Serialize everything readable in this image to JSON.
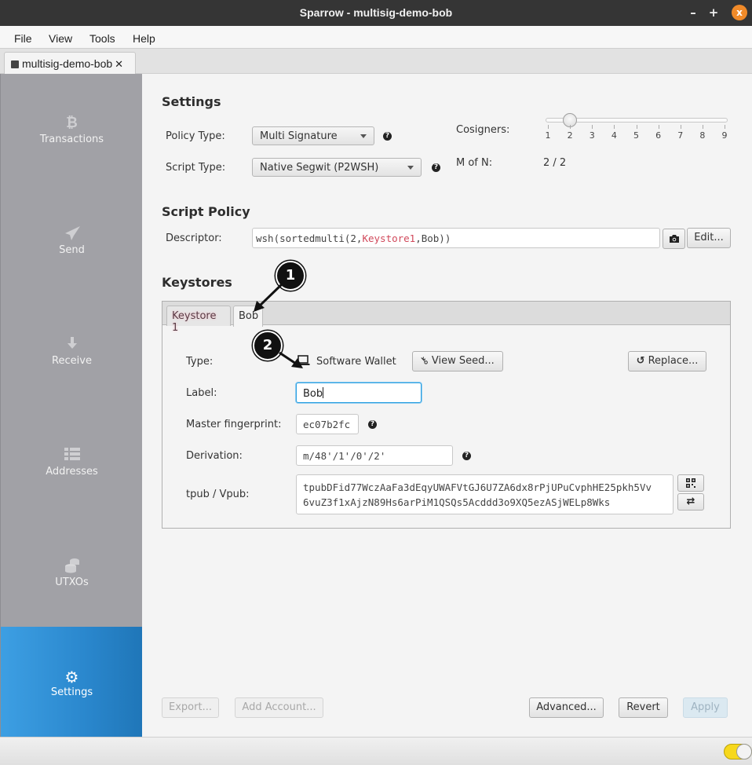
{
  "window": {
    "title": "Sparrow - multisig-demo-bob",
    "minimize": "–",
    "maximize": "+",
    "close": "x"
  },
  "menu": [
    "File",
    "View",
    "Tools",
    "Help"
  ],
  "wallet_tab": {
    "label": "multisig-demo-bob",
    "close": "✕"
  },
  "sidebar": {
    "items": [
      {
        "label": "Transactions",
        "icon": "bitcoin-icon",
        "glyph": "₿"
      },
      {
        "label": "Send",
        "icon": "paper-plane-icon",
        "glyph": "➤"
      },
      {
        "label": "Receive",
        "icon": "arrow-down-icon",
        "glyph": "⬇"
      },
      {
        "label": "Addresses",
        "icon": "list-icon",
        "glyph": "☰"
      },
      {
        "label": "UTXOs",
        "icon": "coins-icon",
        "glyph": "⛁"
      },
      {
        "label": "Settings",
        "icon": "gear-icon",
        "glyph": "⚙"
      }
    ],
    "active": "Settings"
  },
  "settings": {
    "heading": "Settings",
    "policy_type_label": "Policy Type:",
    "policy_type_value": "Multi Signature",
    "script_type_label": "Script Type:",
    "script_type_value": "Native Segwit (P2WSH)",
    "help_glyph": "?",
    "cosigners_label": "Cosigners:",
    "cosigners_value": 2,
    "cosigners_ticks": [
      "1",
      "2",
      "3",
      "4",
      "5",
      "6",
      "7",
      "8",
      "9"
    ],
    "m_of_n_label": "M of N:",
    "m_of_n_value": "2 / 2"
  },
  "script_policy": {
    "heading": "Script Policy",
    "descriptor_label": "Descriptor:",
    "descriptor_prefix": "wsh(sortedmulti(2,",
    "descriptor_keystore": "Keystore1",
    "descriptor_suffix": ",Bob))",
    "edit_label": "Edit...",
    "camera_glyph": "📷"
  },
  "keystores": {
    "heading": "Keystores",
    "tabs": [
      "Keystore 1",
      "Bob"
    ],
    "active_tab": "Bob",
    "type_label": "Type:",
    "type_value": "Software Wallet",
    "view_seed_label": "View Seed...",
    "replace_label": "Replace...",
    "label_label": "Label:",
    "label_value": "Bob",
    "fingerprint_label": "Master fingerprint:",
    "fingerprint_value": "ec07b2fc",
    "derivation_label": "Derivation:",
    "derivation_value": "m/48'/1'/0'/2'",
    "xpub_label": "tpub / Vpub:",
    "xpub_line1": "tpubDFid77WczAaFa3dEqyUWAFVtGJ6U7ZA6dx8rPjUPuCvphHE25pkh5Vv",
    "xpub_line2": "6vuZ3f1xAjzN89Hs6arPiM1QSQs5Acddd3o9XQ5ezASjWELp8Wks"
  },
  "annotations": [
    "1",
    "2"
  ],
  "footer": {
    "export_label": "Export...",
    "add_account_label": "Add Account...",
    "advanced_label": "Advanced...",
    "revert_label": "Revert",
    "apply_label": "Apply"
  },
  "colors": {
    "accent": "#2a87cd",
    "keystore_highlight": "#d1495b",
    "status_toggle": "#f7d81c"
  }
}
